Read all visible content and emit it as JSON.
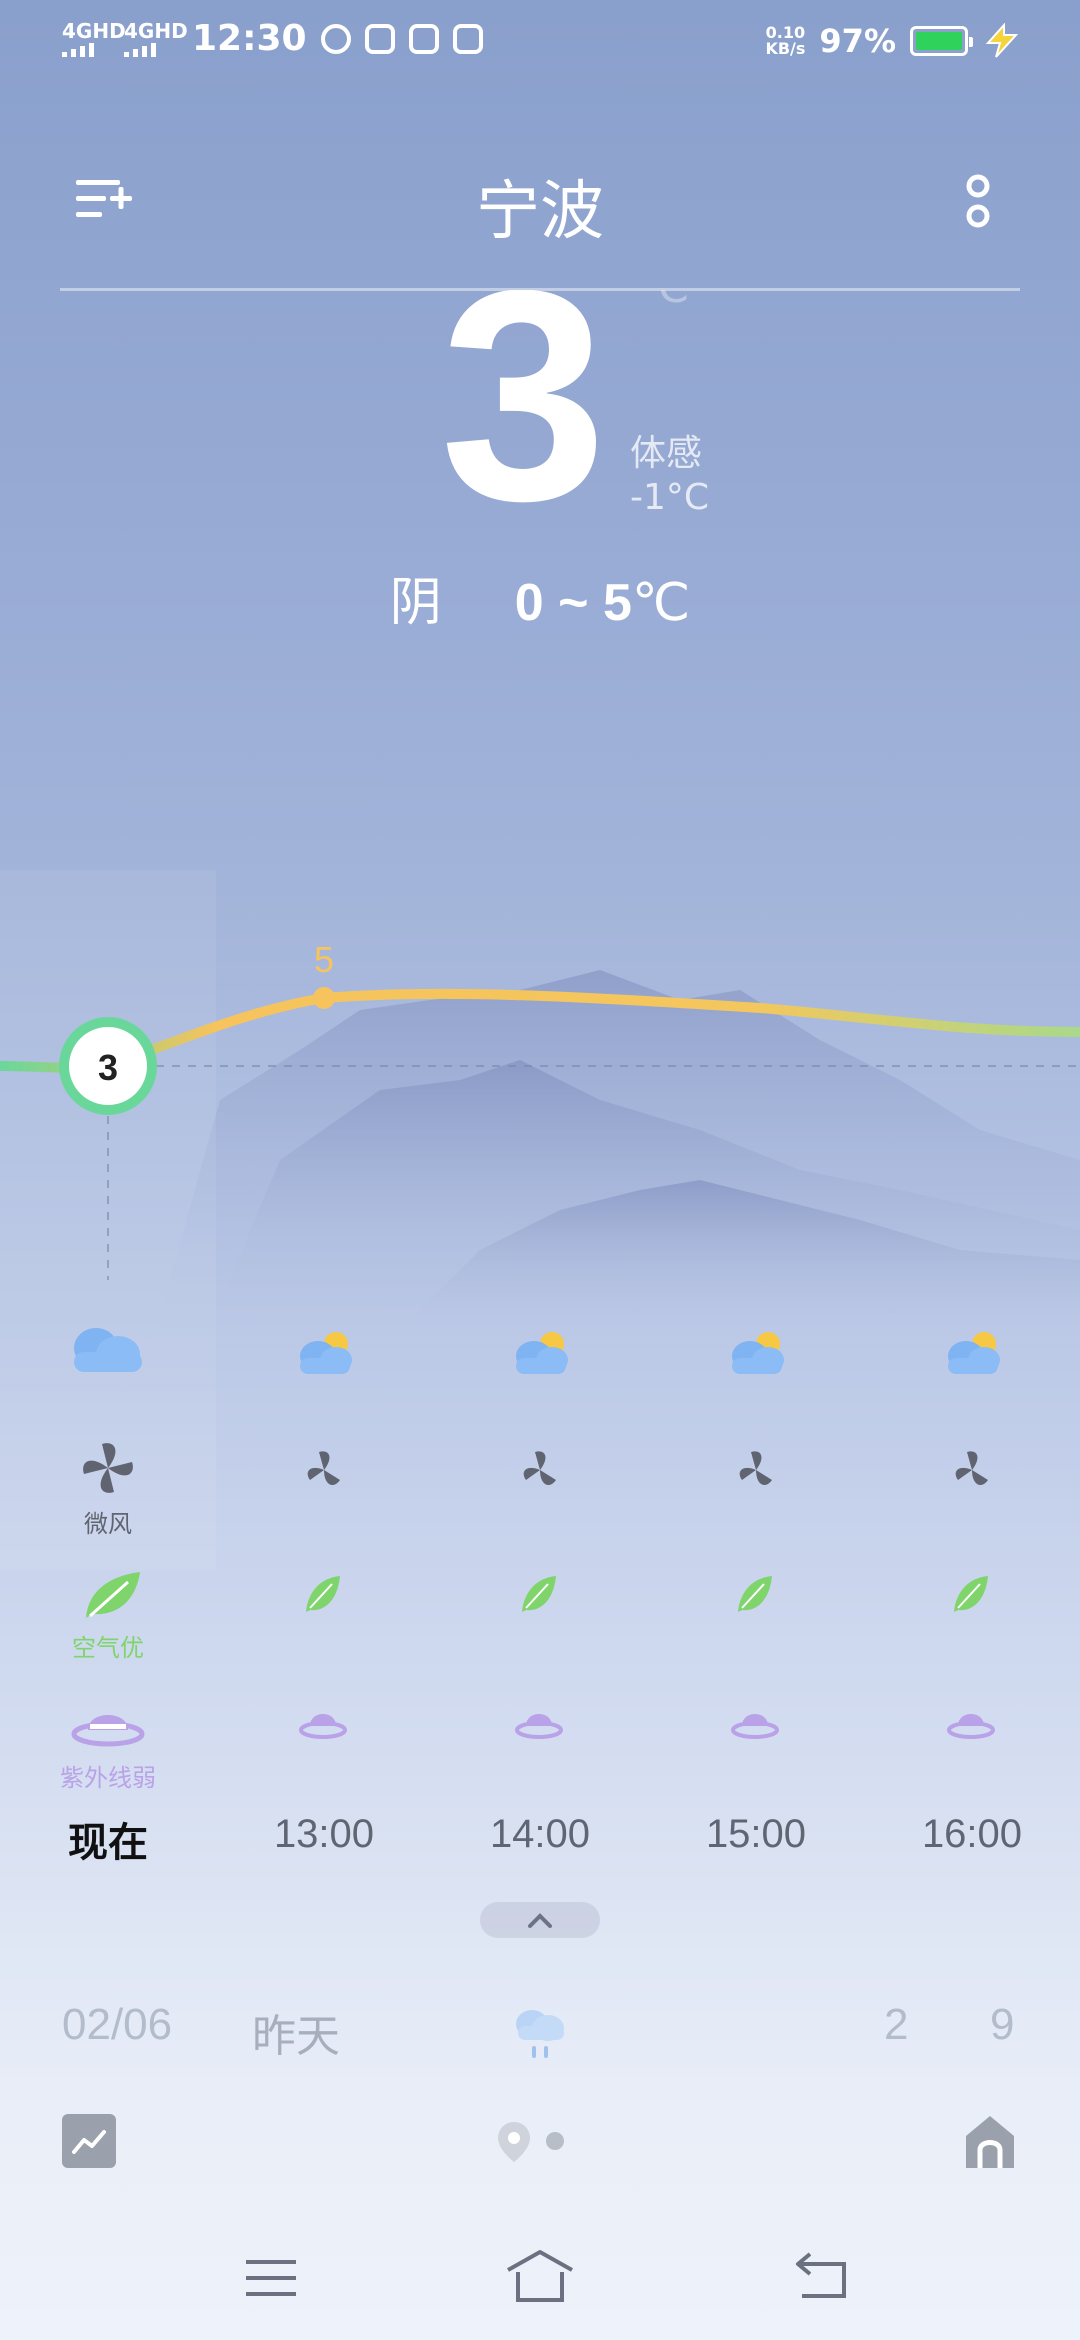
{
  "status_bar": {
    "net1": "4GHD",
    "net2": "4GHD",
    "time": "12:30",
    "speed_value": "0.10",
    "speed_unit": "KB/s",
    "battery": "97%",
    "battery_color": "#2fd25a"
  },
  "header": {
    "city": "宁波"
  },
  "current": {
    "temp": "3",
    "unit": "°C",
    "feels_label": "体感",
    "feels_value": "-1°C",
    "condition": "阴",
    "range": "0 ~ 5",
    "range_unit": "℃"
  },
  "hourly": [
    {
      "time": "现在",
      "temp": "3",
      "wind": "微风",
      "air": "空气优",
      "uv": "紫外线弱"
    },
    {
      "time": "13:00",
      "temp": "5"
    },
    {
      "time": "14:00"
    },
    {
      "time": "15:00"
    },
    {
      "time": "16:00"
    }
  ],
  "daily": {
    "date": "02/06",
    "day": "昨天",
    "low": "2",
    "high": "9"
  },
  "colors": {
    "curve_start": "#6ad79a",
    "curve_peak": "#f7c35c",
    "accent_green": "#7fd46c",
    "accent_purple": "#b9a2e8"
  }
}
